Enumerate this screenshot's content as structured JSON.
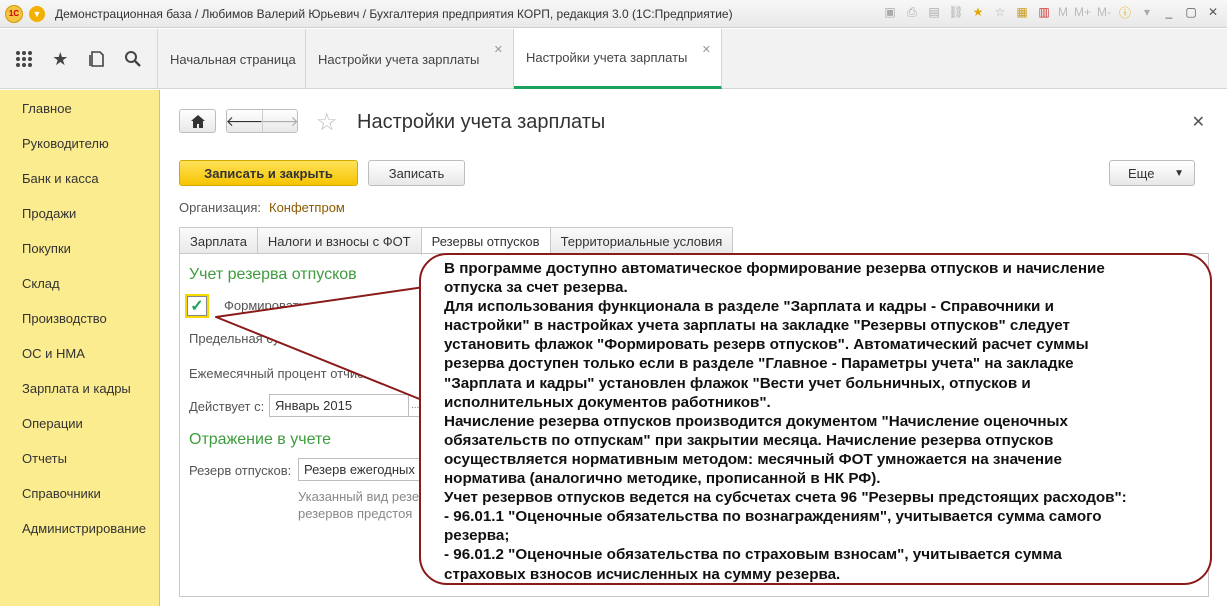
{
  "window": {
    "title": "Демонстрационная база / Любимов Валерий Юрьевич / Бухгалтерия предприятия КОРП, редакция 3.0  (1С:Предприятие)",
    "logo_text": "1С",
    "toolbar": [
      "M",
      "M+",
      "M-"
    ]
  },
  "open_tabs": [
    {
      "label": "Начальная страница"
    },
    {
      "label": "Настройки учета зарплаты"
    },
    {
      "label": "Настройки учета зарплаты"
    }
  ],
  "sidebar": {
    "items": [
      {
        "label": "Главное"
      },
      {
        "label": "Руководителю"
      },
      {
        "label": "Банк и касса"
      },
      {
        "label": "Продажи"
      },
      {
        "label": "Покупки"
      },
      {
        "label": "Склад"
      },
      {
        "label": "Производство"
      },
      {
        "label": "ОС и НМА"
      },
      {
        "label": "Зарплата и кадры"
      },
      {
        "label": "Операции"
      },
      {
        "label": "Отчеты"
      },
      {
        "label": "Справочники"
      },
      {
        "label": "Администрирование"
      }
    ]
  },
  "form": {
    "title": "Настройки учета зарплаты",
    "save_close_label": "Записать и закрыть",
    "save_label": "Записать",
    "more_label": "Еще",
    "org_label": "Организация:",
    "org_value": "Конфетпром",
    "tabs": [
      {
        "label": "Зарплата"
      },
      {
        "label": "Налоги и взносы с ФОТ"
      },
      {
        "label": "Резервы отпусков"
      },
      {
        "label": "Территориальные условия"
      }
    ],
    "section1_title": "Учет резерва отпусков",
    "checkbox_label": "Формировать резерв отпусков",
    "checkbox_checked": true,
    "limit_label": "Предельная сумм",
    "percent_label": "Ежемесячный процент отчислен",
    "valid_from_label": "Действует с:",
    "valid_from_value": "Январь 2015",
    "section2_title": "Отражение в учете",
    "reserve_label": "Резерв отпусков:",
    "reserve_value": "Резерв ежегодных",
    "hint_line1": "Указанный вид резе",
    "hint_line2": "резервов предстоя"
  },
  "callout": {
    "lines": [
      "В программе доступно автоматическое формирование резерва отпусков и начисление",
      "отпуска за счет резерва.",
      "Для использования функционала в разделе \"Зарплата и кадры - Справочники и",
      "настройки\" в настройках учета зарплаты на закладке \"Резервы отпусков\" следует",
      "установить флажок \"Формировать резерв отпусков\". Автоматический расчет суммы",
      "резерва доступен только если в разделе \"Главное - Параметры учета\" на закладке",
      "\"Зарплата и кадры\" установлен флажок \"Вести учет больничных, отпусков и",
      "исполнительных документов работников\".",
      "Начисление резерва отпусков производится документом \"Начисление оценочных",
      "обязательств по отпускам\" при закрытии месяца. Начисление резерва отпусков",
      "осуществляется нормативным методом: месячный ФОТ умножается на значение",
      "норматива (аналогично методике, прописанной в НК РФ).",
      "Учет резервов отпусков ведется на субсчетах счета 96 \"Резервы предстоящих расходов\":",
      "- 96.01.1 \"Оценочные обязательства по вознаграждениям\", учитывается сумма самого",
      "резерва;",
      "- 96.01.2 \"Оценочные обязательства по страховым взносам\", учитывается сумма",
      "страховых взносов исчисленных на сумму резерва."
    ]
  },
  "colors": {
    "sidebar_bg": "#fbec8f",
    "accent_green": "#3e9c3e",
    "primary_button": "#f6c400",
    "callout_border": "#8b1a1a"
  }
}
